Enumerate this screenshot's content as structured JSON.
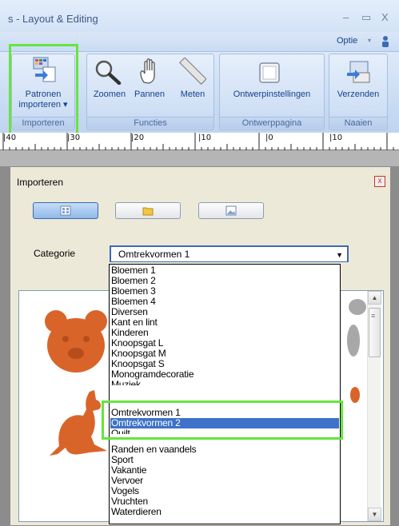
{
  "window": {
    "title": "s - Layout & Editing",
    "min": "–",
    "max": "▭",
    "close": "X"
  },
  "menu": {
    "optie": "Optie",
    "arrow": "▾"
  },
  "ribbon": {
    "groups": [
      {
        "label": "Importeren"
      },
      {
        "label": "Functies"
      },
      {
        "label": "Ontwerppagina"
      },
      {
        "label": "Naaien"
      }
    ],
    "buttons": {
      "patronen_line1": "Patronen",
      "patronen_line2": "importeren ▾",
      "zoomen": "Zoomen",
      "pannen": "Pannen",
      "meten": "Meten",
      "ontwerpinstellingen": "Ontwerpinstellingen",
      "verzenden": "Verzenden"
    }
  },
  "ruler": {
    "labels": [
      "|40",
      "|30",
      "|20",
      "|10",
      "|0",
      "|10"
    ]
  },
  "dialog": {
    "title": "Importeren",
    "close": "x",
    "category_label": "Categorie",
    "category_value": "Omtrekvormen 1",
    "dropdown_items": [
      "Bloemen 1",
      "Bloemen 2",
      "Bloemen 3",
      "Bloemen 4",
      "Diversen",
      "Kant en lint",
      "Kinderen",
      "Knoopsgat L",
      "Knoopsgat M",
      "Knoopsgat S",
      "Monogramdecoratie",
      "Muziek",
      "Omtrekvormen 1",
      "Omtrekvormen 2",
      "Quilt",
      "Randen en vaandels",
      "Sport",
      "Vakantie",
      "Vervoer",
      "Vogels",
      "Vruchten",
      "Waterdieren"
    ],
    "selected_item": "Omtrekvormen 2"
  },
  "colors": {
    "highlight": "#66e53d",
    "selection": "#3d72c8",
    "pattern_orange": "#d9642a"
  }
}
